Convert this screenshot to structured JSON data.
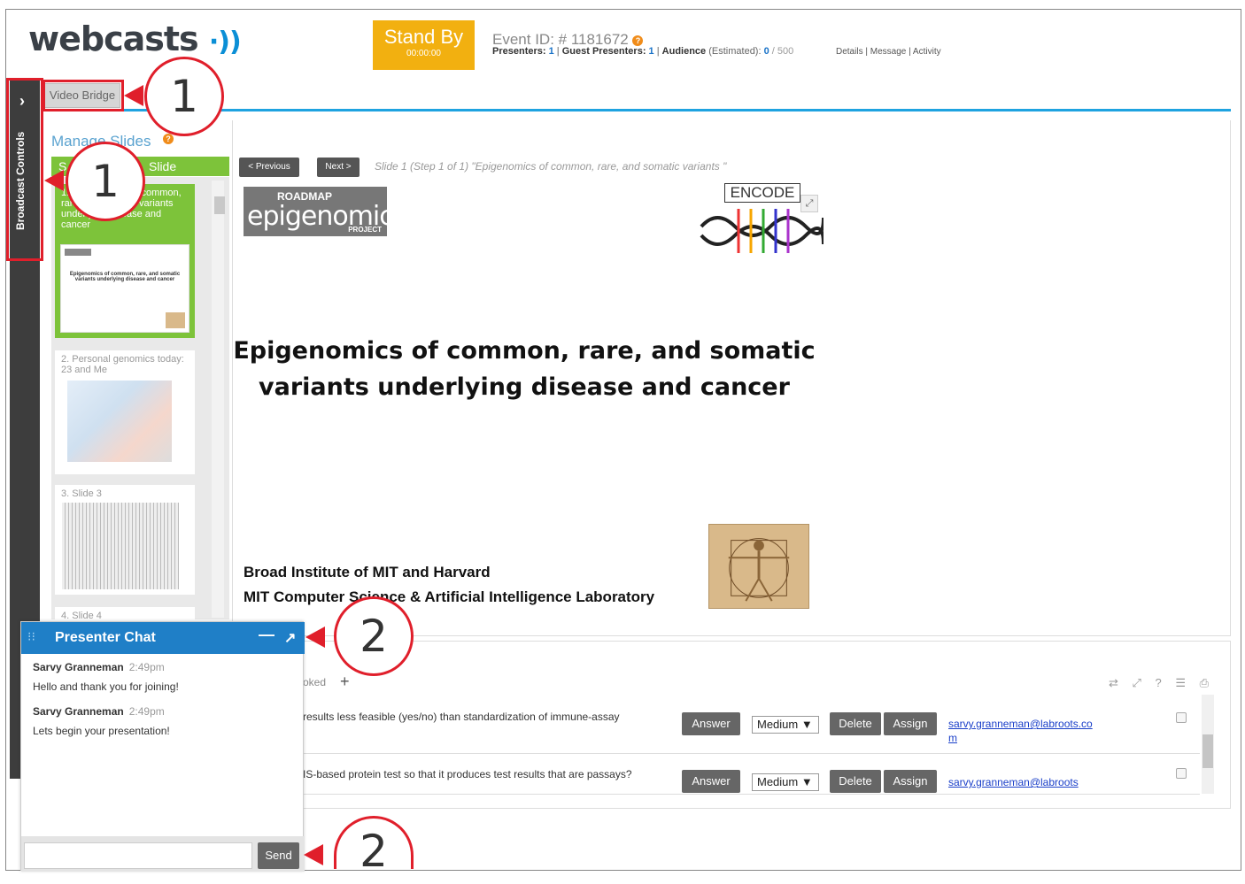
{
  "header": {
    "logo_text": "webcasts",
    "logo_waves": "·))",
    "standby_label": "Stand By",
    "standby_time": "00:00:00",
    "event_id": "Event ID: # 1181672",
    "presenters_label": "Presenters:",
    "presenters_count": "1",
    "guest_label": "Guest Presenters:",
    "guest_count": "1",
    "audience_label": "Audience",
    "audience_estimated": "(Estimated):",
    "audience_count": "0",
    "audience_max": "/ 500",
    "links": [
      "Details",
      "Message",
      "Activity"
    ]
  },
  "tabs": {
    "video_bridge": "Video Bridge"
  },
  "sidebar": {
    "label": "Broadcast Controls"
  },
  "slides": {
    "title": "Manage Slides",
    "list_head_left": "S",
    "list_head_right": "Slide",
    "items": [
      {
        "label": "1. Epigenomics of common, rare, and somatic variants underlying disease and cancer"
      },
      {
        "label": "2. Personal genomics today: 23 and Me"
      },
      {
        "label": "3. Slide 3"
      },
      {
        "label": "4. Slide 4"
      }
    ],
    "prev": "< Previous",
    "next": "Next >",
    "caption": "Slide 1 (Step 1 of 1) \"Epigenomics of common, rare, and somatic variants \""
  },
  "slide_content": {
    "roadmap_top": "ROADMAP",
    "roadmap_mid": "epigenomics",
    "roadmap_bot": "PROJECT",
    "encode": "ENCODE",
    "title": "Epigenomics of common, rare, and somatic variants underlying disease and cancer",
    "inst_1": "Broad Institute of MIT and Harvard",
    "inst_2": "MIT Computer Science & Artificial Intelligence Laboratory"
  },
  "qa": {
    "tab": "oked",
    "plus": "+",
    "icons": "⇄ ⤢ ? ☰ ⎙",
    "rows": [
      {
        "question": "results less feasible (yes/no) than standardization of immune-assay",
        "priority": "Medium ▼",
        "email": "sarvy.granneman@labroots.com"
      },
      {
        "question": "IS-based protein test so that it produces test results that are passays?",
        "priority": "Medium ▼",
        "email": "sarvy.granneman@labroots"
      }
    ],
    "answer": "Answer",
    "delete": "Delete",
    "assign": "Assign"
  },
  "chat": {
    "title": "Presenter Chat",
    "messages": [
      {
        "name": "Sarvy Granneman",
        "time": "2:49pm",
        "text": "Hello and thank you for joining!"
      },
      {
        "name": "Sarvy Granneman",
        "time": "2:49pm",
        "text": "Lets begin your presentation!"
      }
    ],
    "input_value": "",
    "send": "Send"
  },
  "callouts": [
    "1",
    "1",
    "2",
    "2"
  ],
  "colors": {
    "accent": "#1ea3e0",
    "standby": "#f2b010",
    "slide_green": "#7dc33a",
    "chat_blue": "#1f7fc7",
    "callout_red": "#e01f2b"
  }
}
